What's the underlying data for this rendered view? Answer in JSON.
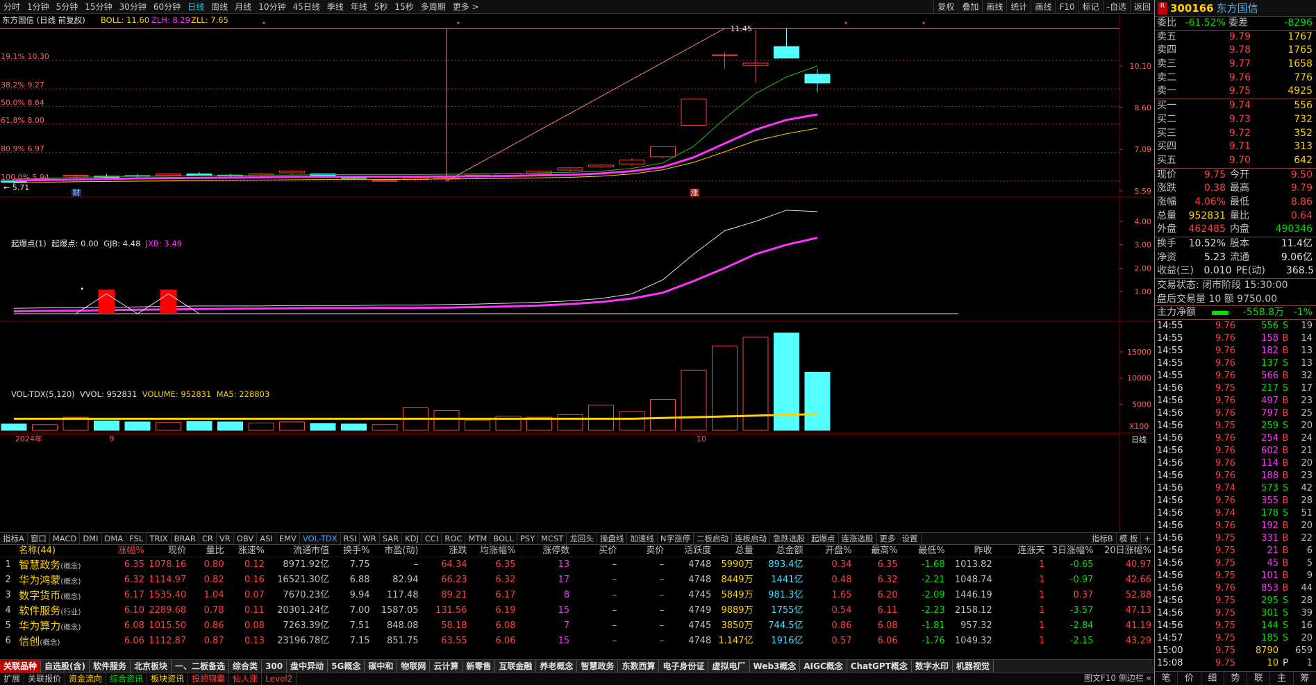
{
  "toolbar": {
    "periods": [
      "分时",
      "1分钟",
      "5分钟",
      "15分钟",
      "30分钟",
      "60分钟",
      "日线",
      "周线",
      "月线",
      "10分钟",
      "45日线",
      "季线",
      "年线",
      "5秒",
      "15秒",
      "多周期",
      "更多 >"
    ],
    "active": "日线",
    "tools": [
      "复权",
      "叠加",
      "画线",
      "统计",
      "画线",
      "F10",
      "标记",
      "-自选",
      "返回"
    ]
  },
  "main_chart": {
    "title": "东方国信 (日线 前复权)",
    "boll_label": "BOLL: 11.60",
    "zlh_label": "ZLH: 8.29",
    "zll_label": "ZLL: 7.65",
    "y_ticks": [
      "10.10",
      "8.60",
      "7.09",
      "5.59"
    ],
    "fib": [
      "19.1% 10.30",
      "38.2% 9.27",
      "50.0% 8.64",
      "61.8% 8.00",
      "80.9% 6.97",
      "100.0% 5.94"
    ],
    "high_mark": "11.45",
    "low_mark": "5.71",
    "markers": [
      "财",
      "涨"
    ]
  },
  "ind_chart": {
    "title": "起爆点(1)",
    "labels": [
      "起爆点: 0.00",
      "GJB: 4.48",
      "JXB: 3.49"
    ],
    "y_ticks": [
      "4.00",
      "3.00",
      "2.00",
      "1.00"
    ]
  },
  "vol_chart": {
    "title": "VOL-TDX(5,120)",
    "labels": [
      "VVOL: 952831",
      "VOLUME: 952831",
      "MA5: 228803"
    ],
    "y_ticks": [
      "15000",
      "10000",
      "5000"
    ],
    "unit": "X100"
  },
  "date_axis": {
    "labels": [
      "2024年",
      "9",
      "10"
    ],
    "period": "日线"
  },
  "indicator_tabs": [
    "指标A",
    "窗口",
    "MACD",
    "DMI",
    "DMA",
    "FSL",
    "TRIX",
    "BRAR",
    "CR",
    "VR",
    "OBV",
    "ASI",
    "EMV",
    "VOL-TDX",
    "RSI",
    "WR",
    "SAR",
    "KDJ",
    "CCI",
    "ROC",
    "MTM",
    "BOLL",
    "PSY",
    "MCST",
    "龙回头",
    "操盘线",
    "加速线",
    "N字涨停",
    "二板启动",
    "连板启动",
    "急跌选股",
    "起爆点",
    "连涨选股",
    "更多",
    "设置"
  ],
  "indicator_tabs_right": [
    "指标B",
    "模 板",
    "+"
  ],
  "table": {
    "headers": [
      "",
      "名称(44)",
      "涨幅%",
      "现价",
      "量比",
      "涨速%",
      "流通市值",
      "换手%",
      "市盈(动)",
      "涨跌",
      "均涨幅%",
      "涨停数",
      "买价",
      "卖价",
      "活跃度",
      "总量",
      "总金额",
      "开盘%",
      "最高%",
      "最低%",
      "昨收",
      "连涨天",
      "3日涨幅%",
      "20日涨幅%"
    ],
    "rows": [
      [
        "1",
        "智慧政务",
        "(概念)",
        "6.35",
        "1078.16",
        "0.80",
        "0.12",
        "8971.92亿",
        "7.75",
        "–",
        "64.34",
        "6.35",
        "13",
        "–",
        "–",
        "4748",
        "5990万",
        "893.4亿",
        "0.34",
        "6.35",
        "-1.68",
        "1013.82",
        "1",
        "-0.65",
        "40.97"
      ],
      [
        "2",
        "华为鸿蒙",
        "(概念)",
        "6.32",
        "1114.97",
        "0.82",
        "0.16",
        "16521.30亿",
        "6.88",
        "82.94",
        "66.23",
        "6.32",
        "17",
        "–",
        "–",
        "4748",
        "8449万",
        "1441亿",
        "0.48",
        "6.32",
        "-2.21",
        "1048.74",
        "1",
        "-0.97",
        "42.66"
      ],
      [
        "3",
        "数字货币",
        "(概念)",
        "6.17",
        "1535.40",
        "1.04",
        "0.07",
        "7670.23亿",
        "9.94",
        "117.48",
        "89.21",
        "6.17",
        "8",
        "–",
        "–",
        "4745",
        "5849万",
        "981.3亿",
        "1.65",
        "6.20",
        "-2.09",
        "1446.19",
        "1",
        "0.37",
        "52.88"
      ],
      [
        "4",
        "软件服务",
        "(行业)",
        "6.10",
        "2289.68",
        "0.78",
        "0.11",
        "20301.24亿",
        "7.00",
        "1587.05",
        "131.56",
        "6.19",
        "15",
        "–",
        "–",
        "4749",
        "9889万",
        "1755亿",
        "0.54",
        "6.11",
        "-2.23",
        "2158.12",
        "1",
        "-3.57",
        "47.13"
      ],
      [
        "5",
        "华为算力",
        "(概念)",
        "6.08",
        "1015.50",
        "0.86",
        "0.08",
        "7263.39亿",
        "7.51",
        "848.08",
        "58.18",
        "6.08",
        "7",
        "–",
        "–",
        "4745",
        "3850万",
        "744.5亿",
        "0.86",
        "6.08",
        "-1.81",
        "957.32",
        "1",
        "-2.84",
        "41.19"
      ],
      [
        "6",
        "信创",
        "(概念)",
        "6.06",
        "1112.87",
        "0.87",
        "0.13",
        "23196.78亿",
        "7.15",
        "851.75",
        "63.55",
        "6.06",
        "15",
        "–",
        "–",
        "4748",
        "1.147亿",
        "1916亿",
        "0.57",
        "6.06",
        "-1.76",
        "1049.32",
        "1",
        "-2.15",
        "43.29"
      ]
    ]
  },
  "block_tabs": [
    "关联品种",
    "自选股(含)",
    "软件服务",
    "北京板块",
    "一、二板备选",
    "综合类",
    "300",
    "盘中异动",
    "5G概念",
    "碳中和",
    "物联网",
    "云计算",
    "新零售",
    "互联金融",
    "养老概念",
    "智慧政务",
    "东数西算",
    "电子身份证",
    "虚拟电厂",
    "Web3概念",
    "AIGC概念",
    "ChatGPT概念",
    "数字水印",
    "机器视觉"
  ],
  "status_bar": [
    "扩展",
    "关联报价",
    "资金流向",
    "综合资讯",
    "板块资讯",
    "投顾锦囊",
    "仙人涨",
    "Level2"
  ],
  "status_right": "图文F10 侧边栏 «",
  "quote": {
    "code": "300166",
    "name": "东方国信",
    "weibi_label": "委比",
    "weibi": "-61.52%",
    "weicha_label": "委差",
    "weicha": "-8296",
    "asks": [
      [
        "卖五",
        "9.79",
        "1767"
      ],
      [
        "卖四",
        "9.78",
        "1765"
      ],
      [
        "卖三",
        "9.77",
        "1658"
      ],
      [
        "卖二",
        "9.76",
        "776"
      ],
      [
        "卖一",
        "9.75",
        "4925"
      ]
    ],
    "bids": [
      [
        "买一",
        "9.74",
        "556"
      ],
      [
        "买二",
        "9.73",
        "732"
      ],
      [
        "买三",
        "9.72",
        "352"
      ],
      [
        "买四",
        "9.71",
        "313"
      ],
      [
        "买五",
        "9.70",
        "642"
      ]
    ],
    "stats": [
      [
        "现价",
        "9.75",
        "今开",
        "9.50"
      ],
      [
        "涨跌",
        "0.38",
        "最高",
        "9.79"
      ],
      [
        "涨幅",
        "4.06%",
        "最低",
        "8.86"
      ],
      [
        "总量",
        "952831",
        "量比",
        "0.64"
      ],
      [
        "外盘",
        "462485",
        "内盘",
        "490346"
      ]
    ],
    "stats2": [
      [
        "换手",
        "10.52%",
        "股本",
        "11.4亿"
      ],
      [
        "净资",
        "5.23",
        "流通",
        "9.06亿"
      ],
      [
        "收益(三)",
        "0.010",
        "PE(动)",
        "368.5"
      ]
    ],
    "trade_status": "交易状态: 闭市阶段 15:30:00",
    "after_hours": "盘后交易量 10 额 9750.00",
    "main_flow_label": "主力净额",
    "main_flow": "-558.8万",
    "main_flow_pct": "-1%"
  },
  "ticks": [
    [
      "14:55",
      "9.76",
      "556",
      "S",
      "19"
    ],
    [
      "14:55",
      "9.76",
      "158",
      "B",
      "14"
    ],
    [
      "14:55",
      "9.76",
      "182",
      "B",
      "13"
    ],
    [
      "14:55",
      "9.76",
      "137",
      "S",
      "13"
    ],
    [
      "14:55",
      "9.76",
      "566",
      "B",
      "32"
    ],
    [
      "14:56",
      "9.75",
      "217",
      "S",
      "17"
    ],
    [
      "14:56",
      "9.76",
      "497",
      "B",
      "23"
    ],
    [
      "14:56",
      "9.76",
      "797",
      "B",
      "25"
    ],
    [
      "14:56",
      "9.75",
      "259",
      "S",
      "20"
    ],
    [
      "14:56",
      "9.76",
      "254",
      "B",
      "24"
    ],
    [
      "14:56",
      "9.76",
      "602",
      "B",
      "21"
    ],
    [
      "14:56",
      "9.76",
      "114",
      "B",
      "20"
    ],
    [
      "14:56",
      "9.76",
      "188",
      "B",
      "23"
    ],
    [
      "14:56",
      "9.74",
      "573",
      "S",
      "42"
    ],
    [
      "14:56",
      "9.76",
      "355",
      "B",
      "28"
    ],
    [
      "14:56",
      "9.74",
      "178",
      "S",
      "51"
    ],
    [
      "14:56",
      "9.76",
      "192",
      "B",
      "20"
    ],
    [
      "14:56",
      "9.75",
      "331",
      "B",
      "22"
    ],
    [
      "14:56",
      "9.75",
      "21",
      "B",
      "6"
    ],
    [
      "14:56",
      "9.75",
      "45",
      "B",
      "5"
    ],
    [
      "14:56",
      "9.75",
      "101",
      "B",
      "9"
    ],
    [
      "14:56",
      "9.76",
      "853",
      "B",
      "44"
    ],
    [
      "14:56",
      "9.75",
      "295",
      "S",
      "28"
    ],
    [
      "14:56",
      "9.75",
      "301",
      "S",
      "39"
    ],
    [
      "14:56",
      "9.75",
      "144",
      "S",
      "16"
    ],
    [
      "14:57",
      "9.75",
      "185",
      "S",
      "20"
    ],
    [
      "15:00",
      "9.75",
      "8790",
      "",
      "659"
    ],
    [
      "15:08",
      "9.75",
      "10",
      "P",
      "1"
    ]
  ],
  "rp_bottom": [
    "笔",
    "价",
    "细",
    "势",
    "联",
    "主",
    "筹"
  ],
  "colors": {
    "up": "#ff4040",
    "down": "#00e000",
    "boll_mid": "#ffffff",
    "ma_magenta": "#ff33ff",
    "ma_yellow": "#ffd200",
    "bear_fill": "#54ffff"
  }
}
